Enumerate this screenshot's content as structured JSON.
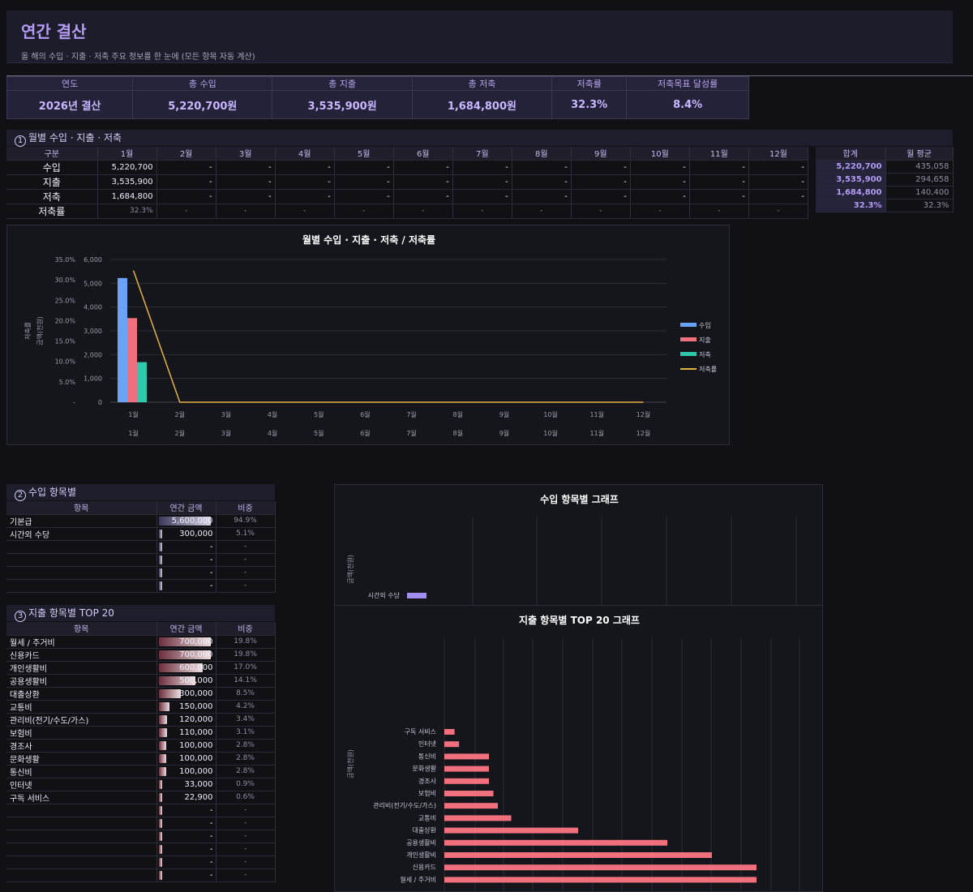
{
  "header": {
    "title": "연간 결산",
    "subtitle": "올 해의 수입 · 지출 · 저축 주요 정보를 한 눈에 (모든 항목 자동 계산)"
  },
  "summary": {
    "headers": [
      "연도",
      "총 수입",
      "총 지출",
      "총 저축",
      "저축률",
      "저축목표 달성률"
    ],
    "values": [
      "2026년 결산",
      "5,220,700원",
      "3,535,900원",
      "1,684,800원",
      "32.3%",
      "8.4%"
    ]
  },
  "monthly": {
    "section_num": "1",
    "section_title": "월별 수입 · 지출 · 저축",
    "col_header": "구분",
    "months": [
      "1월",
      "2월",
      "3월",
      "4월",
      "5월",
      "6월",
      "7월",
      "8월",
      "9월",
      "10월",
      "11월",
      "12월"
    ],
    "rows": [
      {
        "label": "수입",
        "values": [
          "5,220,700",
          "-",
          "-",
          "-",
          "-",
          "-",
          "-",
          "-",
          "-",
          "-",
          "-",
          "-"
        ]
      },
      {
        "label": "지출",
        "values": [
          "3,535,900",
          "-",
          "-",
          "-",
          "-",
          "-",
          "-",
          "-",
          "-",
          "-",
          "-",
          "-"
        ]
      },
      {
        "label": "저축",
        "values": [
          "1,684,800",
          "-",
          "-",
          "-",
          "-",
          "-",
          "-",
          "-",
          "-",
          "-",
          "-",
          "-"
        ]
      },
      {
        "label": "저축률",
        "values": [
          "32.3%",
          "-",
          "-",
          "-",
          "-",
          "-",
          "-",
          "-",
          "-",
          "-",
          "-",
          "-"
        ]
      }
    ],
    "totals_headers": [
      "합계",
      "월 평균"
    ],
    "totals": [
      [
        "5,220,700",
        "435,058"
      ],
      [
        "3,535,900",
        "294,658"
      ],
      [
        "1,684,800",
        "140,400"
      ],
      [
        "32.3%",
        "32.3%"
      ]
    ]
  },
  "chart_data": [
    {
      "type": "bar",
      "title": "월별 수입 · 지출 · 저축 / 저축률",
      "categories": [
        "1월",
        "2월",
        "3월",
        "4월",
        "5월",
        "6월",
        "7월",
        "8월",
        "9월",
        "10월",
        "11월",
        "12월"
      ],
      "ylabel": "금액(천원)",
      "y2label": "저축률",
      "ylim": [
        0,
        6000
      ],
      "y_ticks": [
        "0",
        "1,000",
        "2,000",
        "3,000",
        "4,000",
        "5,000",
        "6,000"
      ],
      "y2lim": [
        0,
        35
      ],
      "y2_ticks": [
        "-",
        "5.0%",
        "10.0%",
        "15.0%",
        "20.0%",
        "25.0%",
        "30.0%",
        "35.0%"
      ],
      "legend_position": "right",
      "series": [
        {
          "name": "수입",
          "type": "bar",
          "color": "#6aa3f5",
          "values": [
            5220.7,
            0,
            0,
            0,
            0,
            0,
            0,
            0,
            0,
            0,
            0,
            0
          ]
        },
        {
          "name": "지출",
          "type": "bar",
          "color": "#f0707e",
          "values": [
            3535.9,
            0,
            0,
            0,
            0,
            0,
            0,
            0,
            0,
            0,
            0,
            0
          ]
        },
        {
          "name": "저축",
          "type": "bar",
          "color": "#2ec9ad",
          "values": [
            1684.8,
            0,
            0,
            0,
            0,
            0,
            0,
            0,
            0,
            0,
            0,
            0
          ]
        },
        {
          "name": "저축률",
          "type": "line",
          "axis": "y2",
          "color": "#e3b341",
          "values": [
            32.3,
            0,
            0,
            0,
            0,
            0,
            0,
            0,
            0,
            0,
            0,
            0
          ]
        }
      ]
    },
    {
      "type": "bar",
      "orientation": "horizontal",
      "title": "수입 항목별 그래프",
      "ylabel": "금액(천원)",
      "categories": [
        "시간외 수당"
      ],
      "series": [
        {
          "color": "#a48ef0",
          "values": [
            300
          ]
        }
      ]
    },
    {
      "type": "bar",
      "orientation": "horizontal",
      "title": "지출 항목별 TOP 20 그래프",
      "ylabel": "금액(천원)",
      "categories": [
        "구독 서비스",
        "인터넷",
        "통신비",
        "문화생활",
        "경조사",
        "보험비",
        "관리비(전기/수도/가스)",
        "교통비",
        "대출상환",
        "공용생활비",
        "개인생활비",
        "신용카드",
        "월세 / 주거비"
      ],
      "series": [
        {
          "color": "#f0707e",
          "values": [
            22.9,
            33,
            100,
            100,
            100,
            110,
            120,
            150,
            300,
            500,
            600,
            700,
            700
          ]
        }
      ]
    }
  ],
  "income_items": {
    "section_num": "2",
    "section_title": "수입 항목별",
    "headers": [
      "항목",
      "연간 금액",
      "비중"
    ],
    "rows": [
      {
        "name": "기본급",
        "amount": "5,600,000",
        "pct": "94.9%",
        "fill": 1.0
      },
      {
        "name": "시간외 수당",
        "amount": "300,000",
        "pct": "5.1%",
        "fill": 0.054
      },
      {
        "name": "",
        "amount": "-",
        "pct": "-",
        "fill": 0.0
      },
      {
        "name": "",
        "amount": "-",
        "pct": "-",
        "fill": 0.0
      },
      {
        "name": "",
        "amount": "-",
        "pct": "-",
        "fill": 0.0
      },
      {
        "name": "",
        "amount": "-",
        "pct": "-",
        "fill": 0.0
      }
    ]
  },
  "expense_items": {
    "section_num": "3",
    "section_title": "지출 항목별 TOP 20",
    "headers": [
      "항목",
      "연간 금액",
      "비중"
    ],
    "rows": [
      {
        "name": "월세 / 주거비",
        "amount": "700,000",
        "pct": "19.8%",
        "fill": 1.0
      },
      {
        "name": "신용카드",
        "amount": "700,000",
        "pct": "19.8%",
        "fill": 1.0
      },
      {
        "name": "개인생활비",
        "amount": "600,000",
        "pct": "17.0%",
        "fill": 0.857
      },
      {
        "name": "공용생활비",
        "amount": "500,000",
        "pct": "14.1%",
        "fill": 0.714
      },
      {
        "name": "대출상환",
        "amount": "300,000",
        "pct": "8.5%",
        "fill": 0.429
      },
      {
        "name": "교통비",
        "amount": "150,000",
        "pct": "4.2%",
        "fill": 0.214
      },
      {
        "name": "관리비(전기/수도/가스)",
        "amount": "120,000",
        "pct": "3.4%",
        "fill": 0.171
      },
      {
        "name": "보험비",
        "amount": "110,000",
        "pct": "3.1%",
        "fill": 0.157
      },
      {
        "name": "경조사",
        "amount": "100,000",
        "pct": "2.8%",
        "fill": 0.143
      },
      {
        "name": "문화생활",
        "amount": "100,000",
        "pct": "2.8%",
        "fill": 0.143
      },
      {
        "name": "통신비",
        "amount": "100,000",
        "pct": "2.8%",
        "fill": 0.143
      },
      {
        "name": "인터넷",
        "amount": "33,000",
        "pct": "0.9%",
        "fill": 0.047
      },
      {
        "name": "구독 서비스",
        "amount": "22,900",
        "pct": "0.6%",
        "fill": 0.033
      },
      {
        "name": "",
        "amount": "-",
        "pct": "-",
        "fill": 0.0
      },
      {
        "name": "",
        "amount": "-",
        "pct": "-",
        "fill": 0.0
      },
      {
        "name": "",
        "amount": "-",
        "pct": "-",
        "fill": 0.0
      },
      {
        "name": "",
        "amount": "-",
        "pct": "-",
        "fill": 0.0
      },
      {
        "name": "",
        "amount": "-",
        "pct": "-",
        "fill": 0.0
      },
      {
        "name": "",
        "amount": "-",
        "pct": "-",
        "fill": 0.0
      }
    ]
  }
}
